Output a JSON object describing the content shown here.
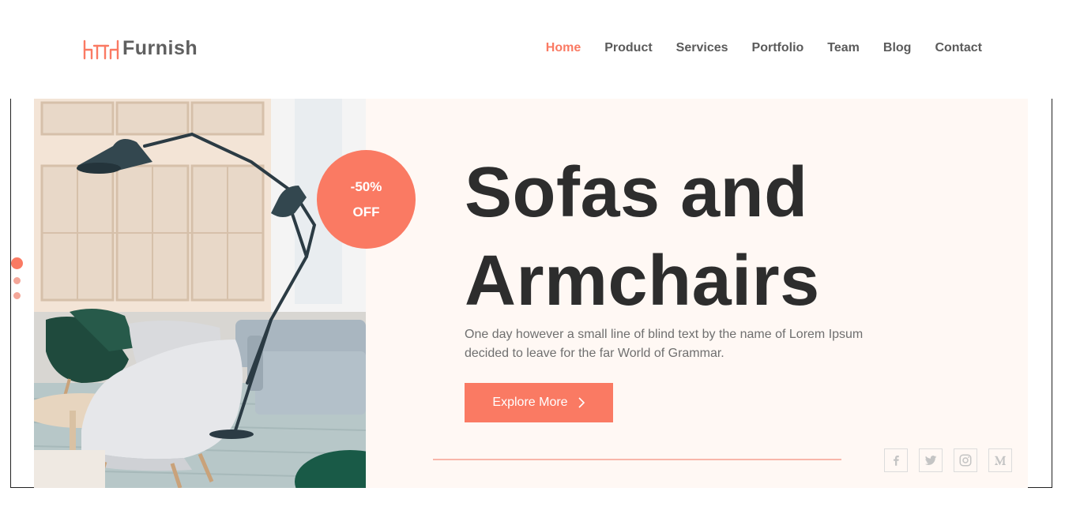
{
  "brand": {
    "name": "Furnish",
    "accent": "#fa7a63"
  },
  "nav": {
    "items": [
      {
        "label": "Home",
        "active": true
      },
      {
        "label": "Product"
      },
      {
        "label": "Services"
      },
      {
        "label": "Portfolio"
      },
      {
        "label": "Team"
      },
      {
        "label": "Blog"
      },
      {
        "label": "Contact"
      }
    ]
  },
  "hero": {
    "badge": {
      "line1": "-50%",
      "line2": "OFF"
    },
    "title": {
      "word1": "Sofas",
      "word2": "and",
      "word3": "Armchairs"
    },
    "description": "One day however a small line of blind text by the name of Lorem Ipsum decided to leave for the far World of Grammar.",
    "cta_label": "Explore More",
    "slides": {
      "count": 3,
      "active": 1
    }
  },
  "socials": [
    {
      "icon": "facebook-icon",
      "glyph": "f"
    },
    {
      "icon": "twitter-icon",
      "glyph": "t"
    },
    {
      "icon": "instagram-icon",
      "glyph": "ig"
    },
    {
      "icon": "medium-icon",
      "glyph": "M"
    }
  ]
}
